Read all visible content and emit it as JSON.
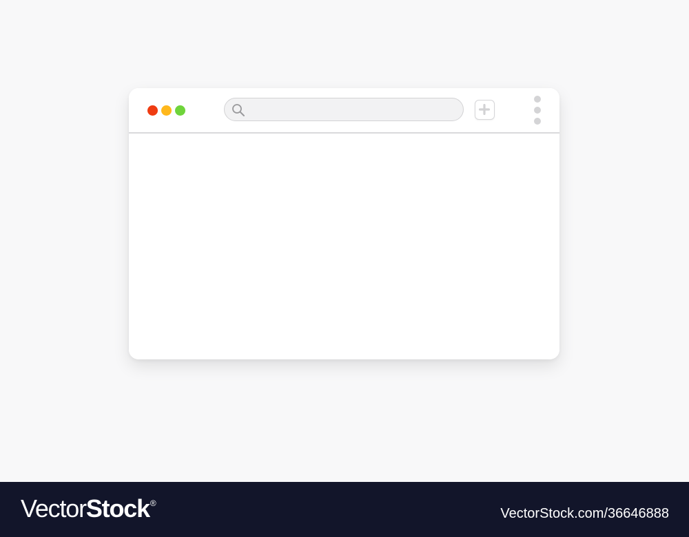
{
  "browser": {
    "traffic_lights": [
      {
        "name": "close",
        "color": "#ef3c12"
      },
      {
        "name": "minimize",
        "color": "#ffb81c"
      },
      {
        "name": "maximize",
        "color": "#6fd43b"
      }
    ],
    "search": {
      "icon": "search-icon",
      "value": "",
      "placeholder": ""
    },
    "new_tab_icon": "plus-icon",
    "menu_icon": "vertical-dots-icon"
  },
  "footer": {
    "brand_light": "Vector",
    "brand_bold": "Stock",
    "brand_mark": "®",
    "image_reference": "VectorStock.com/36646888"
  },
  "colors": {
    "page_background": "#f8f8f9",
    "window_background": "#ffffff",
    "footer_background": "#12152a",
    "divider": "#d9d9db"
  }
}
